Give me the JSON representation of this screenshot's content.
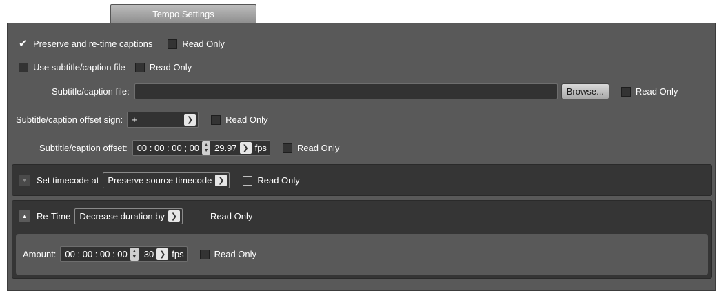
{
  "tab": {
    "label": "Tempo Settings"
  },
  "preserve": {
    "label": "Preserve and re-time captions",
    "checked": true,
    "read_only_label": "Read Only"
  },
  "use_file": {
    "label": "Use subtitle/caption file",
    "read_only_label": "Read Only"
  },
  "caption_file": {
    "label": "Subtitle/caption file:",
    "value": "",
    "browse_label": "Browse...",
    "read_only_label": "Read Only"
  },
  "offset_sign": {
    "label": "Subtitle/caption offset sign:",
    "value": "+",
    "read_only_label": "Read Only"
  },
  "offset": {
    "label": "Subtitle/caption offset:",
    "timecode": "00 : 00 : 00 ; 00",
    "rate": "29.97",
    "unit": "fps",
    "read_only_label": "Read Only"
  },
  "set_timecode": {
    "label": "Set timecode at",
    "value": "Preserve source timecode",
    "read_only_label": "Read Only"
  },
  "retime": {
    "label": "Re-Time",
    "value": "Decrease duration by",
    "read_only_label": "Read Only"
  },
  "amount": {
    "label": "Amount:",
    "timecode": "00 : 00 : 00 : 00",
    "rate": "30",
    "unit": "fps",
    "read_only_label": "Read Only"
  },
  "icons": {
    "check": "checkmark-icon",
    "dropdown": "chevron-down-icon",
    "spinner": "spinner-icon",
    "expand": "triangle-icon"
  }
}
